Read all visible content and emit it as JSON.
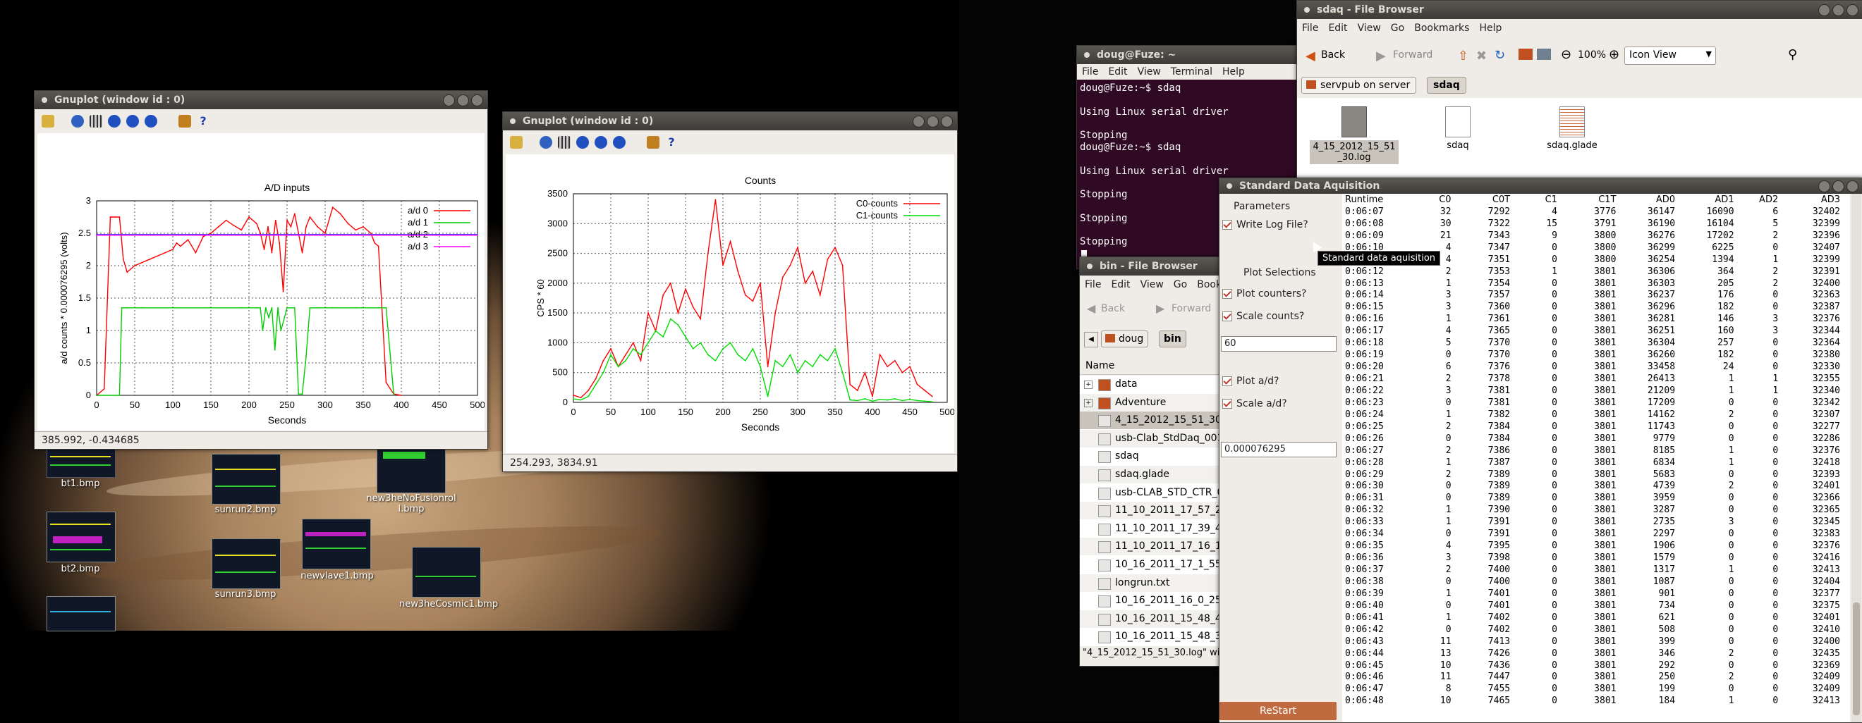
{
  "gnuplot_ad": {
    "title": "Gnuplot (window id : 0)",
    "chart_title": "A/D inputs",
    "status": "385.992, -0.434685",
    "chart_data": {
      "type": "line",
      "title": "A/D inputs",
      "xlabel": "Seconds",
      "ylabel": "a/d counts * 0.000076295 (volts)",
      "xlim": [
        0,
        500
      ],
      "ylim": [
        0,
        3
      ],
      "x_ticks": [
        "0",
        "50",
        "100",
        "150",
        "200",
        "250",
        "300",
        "350",
        "400",
        "450",
        "500"
      ],
      "y_ticks": [
        "0",
        "0.5",
        "1",
        "1.5",
        "2",
        "2.5",
        "3"
      ],
      "grid": true,
      "legend": "top-right",
      "series": [
        {
          "name": "a/d 0",
          "color": "#ff0000",
          "x": [
            0,
            10,
            18,
            20,
            25,
            30,
            35,
            40,
            50,
            70,
            90,
            100,
            105,
            110,
            120,
            130,
            140,
            150,
            160,
            170,
            180,
            190,
            200,
            210,
            215,
            220,
            225,
            230,
            235,
            240,
            245,
            250,
            255,
            260,
            265,
            270,
            275,
            280,
            290,
            300,
            310,
            320,
            330,
            340,
            350,
            360,
            365,
            370,
            380,
            390,
            400
          ],
          "y": [
            0,
            0.1,
            2.75,
            2.75,
            2.75,
            2.75,
            2.1,
            1.9,
            2.0,
            2.1,
            2.2,
            2.25,
            2.35,
            2.3,
            2.4,
            2.2,
            2.45,
            2.5,
            2.6,
            2.7,
            2.62,
            2.55,
            2.75,
            2.65,
            2.5,
            2.25,
            2.6,
            2.2,
            2.7,
            2.35,
            1.6,
            2.7,
            2.6,
            2.8,
            2.5,
            2.2,
            2.6,
            2.75,
            2.6,
            2.5,
            2.9,
            2.8,
            2.65,
            2.55,
            2.6,
            2.5,
            2.35,
            2.3,
            0.2,
            0.02,
            0
          ]
        },
        {
          "name": "a/d 1",
          "color": "#00cc00",
          "x": [
            0,
            30,
            33,
            36,
            40,
            60,
            100,
            150,
            190,
            200,
            210,
            215,
            218,
            222,
            226,
            230,
            234,
            238,
            242,
            250,
            260,
            265,
            270,
            275,
            280,
            290,
            300,
            310,
            340,
            348,
            350,
            370,
            380,
            390
          ],
          "y": [
            0,
            0,
            1.35,
            1.35,
            1.35,
            1.35,
            1.35,
            1.35,
            1.35,
            1.35,
            1.35,
            1.35,
            1.0,
            1.35,
            1.2,
            1.35,
            0.7,
            1.35,
            1.0,
            1.35,
            1.35,
            0.02,
            0.02,
            0.6,
            1.35,
            1.35,
            1.35,
            1.35,
            1.35,
            1.35,
            1.35,
            1.35,
            1.35,
            0.02
          ]
        },
        {
          "name": "a/d 2",
          "color": "#3333ff",
          "x": [
            0,
            500
          ],
          "y": [
            2.48,
            2.48
          ]
        },
        {
          "name": "a/d 3",
          "color": "#ff00ff",
          "x": [
            0,
            500
          ],
          "y": [
            2.47,
            2.47
          ]
        }
      ]
    }
  },
  "gnuplot_counts": {
    "title": "Gnuplot (window id : 0)",
    "chart_title": "Counts",
    "status": "254.293,  3834.91",
    "chart_data": {
      "type": "line",
      "title": "Counts",
      "xlabel": "Seconds",
      "ylabel": "CPS * 60",
      "xlim": [
        0,
        500
      ],
      "ylim": [
        0,
        3500
      ],
      "x_ticks": [
        "0",
        "50",
        "100",
        "150",
        "200",
        "250",
        "300",
        "350",
        "400",
        "450",
        "500"
      ],
      "y_ticks": [
        "0",
        "500",
        "1000",
        "1500",
        "2000",
        "2500",
        "3000",
        "3500"
      ],
      "grid": true,
      "legend": "top-right",
      "series": [
        {
          "name": "C0-counts",
          "color": "#ff0000",
          "x": [
            0,
            10,
            20,
            30,
            40,
            50,
            60,
            70,
            80,
            90,
            100,
            110,
            120,
            130,
            140,
            150,
            160,
            170,
            180,
            190,
            200,
            210,
            220,
            230,
            240,
            250,
            260,
            270,
            280,
            290,
            300,
            310,
            320,
            330,
            340,
            350,
            360,
            370,
            380,
            390,
            400,
            410,
            420,
            430,
            440,
            450,
            460,
            470,
            480
          ],
          "y": [
            120,
            80,
            200,
            400,
            700,
            900,
            600,
            800,
            1000,
            700,
            1500,
            1200,
            1800,
            2000,
            1500,
            1900,
            1600,
            1400,
            2500,
            3400,
            2300,
            2700,
            2200,
            1800,
            1700,
            2000,
            600,
            1500,
            2100,
            2300,
            2600,
            2000,
            2200,
            1800,
            2400,
            2600,
            2300,
            300,
            200,
            500,
            100,
            800,
            600,
            700,
            500,
            600,
            300,
            200,
            100
          ]
        },
        {
          "name": "C1-counts",
          "color": "#00dd00",
          "x": [
            0,
            10,
            20,
            30,
            40,
            50,
            60,
            70,
            80,
            90,
            100,
            110,
            120,
            130,
            140,
            150,
            160,
            170,
            180,
            190,
            200,
            210,
            220,
            230,
            240,
            250,
            260,
            270,
            280,
            290,
            300,
            310,
            320,
            330,
            340,
            350,
            360,
            370,
            380,
            390,
            400,
            410,
            420,
            430,
            440,
            450,
            460,
            470,
            480
          ],
          "y": [
            60,
            40,
            100,
            300,
            500,
            800,
            600,
            700,
            900,
            800,
            1000,
            1200,
            1100,
            1400,
            1300,
            1100,
            900,
            1000,
            800,
            700,
            900,
            1000,
            800,
            700,
            900,
            600,
            100,
            700,
            600,
            800,
            500,
            700,
            600,
            800,
            700,
            900,
            500,
            40,
            30,
            60,
            20,
            50,
            40,
            60,
            30,
            50,
            30,
            20,
            10
          ]
        }
      ]
    }
  },
  "desktop_icons": [
    {
      "label": "bt1.bmp"
    },
    {
      "label": "bt2.bmp"
    },
    {
      "label": "sunrun2.bmp"
    },
    {
      "label": "sunrun3.bmp"
    },
    {
      "label": "newvlave1.bmp"
    },
    {
      "label": "new3heNoFusionroll.bmp"
    },
    {
      "label": "new3heCosmic1.bmp"
    }
  ],
  "terminal": {
    "title": "doug@Fuze: ~",
    "menu": [
      "File",
      "Edit",
      "View",
      "Terminal",
      "Help"
    ],
    "lines": [
      "doug@Fuze:~$ sdaq",
      "",
      "Using Linux serial driver",
      "",
      "Stopping",
      "doug@Fuze:~$ sdaq",
      "",
      "Using Linux serial driver",
      "",
      "Stopping",
      "",
      "Stopping",
      "",
      "Stopping"
    ]
  },
  "file_browser_sdaq": {
    "title": "sdaq - File Browser",
    "menu": [
      "File",
      "Edit",
      "View",
      "Go",
      "Bookmarks",
      "Help"
    ],
    "back": "Back",
    "forward": "Forward",
    "zoom": "100%",
    "view_mode": "Icon View",
    "path_server": "servpub on server",
    "path_current": "sdaq",
    "files": [
      "4_15_2012_15_51_30.log",
      "sdaq",
      "sdaq.glade"
    ]
  },
  "file_browser_bin": {
    "title": "bin - File Browser",
    "menu": [
      "File",
      "Edit",
      "View",
      "Go",
      "Bookmarks"
    ],
    "back": "Back",
    "forward": "Forward",
    "path_home": "doug",
    "path_current": "bin",
    "column": "Name",
    "items": [
      "data",
      "Adventure",
      "4_15_2012_15_51_30.",
      "usb-Clab_StdDaq_001",
      "sdaq",
      "sdaq.glade",
      "usb-CLAB_STD_CTR_0",
      "11_10_2011_17_57_24",
      "11_10_2011_17_39_42",
      "11_10_2011_17_16_10",
      "10_16_2011_17_1_55.",
      "longrun.txt",
      "10_16_2011_16_0_25.",
      "10_16_2011_15_48_41",
      "10_16_2011_15_48_37"
    ],
    "status": "\"4_15_2012_15_51_30.log\" wi"
  },
  "sdaq_window": {
    "title": "Standard Data Aquisition",
    "tooltip": "Standard data aquisition",
    "params_label": "Parameters",
    "write_log": "Write Log File?",
    "plot_selections": "Plot Selections",
    "plot_counters": "Plot counters?",
    "scale_counts": "Scale counts?",
    "scale_counts_value": "60",
    "plot_ad": "Plot a/d?",
    "scale_ad": "Scale a/d?",
    "scale_ad_value": "0.000076295",
    "restart": "ReStart",
    "columns": [
      "Runtime",
      "C0",
      "C0T",
      "C1",
      "C1T",
      "AD0",
      "AD1",
      "AD2",
      "AD3"
    ],
    "rows": [
      [
        "0:06:07",
        "32",
        "7292",
        "4",
        "3776",
        "36147",
        "16090",
        "6",
        "32402"
      ],
      [
        "0:06:08",
        "30",
        "7322",
        "15",
        "3791",
        "36190",
        "16104",
        "5",
        "32399"
      ],
      [
        "0:06:09",
        "21",
        "7343",
        "9",
        "3800",
        "36276",
        "17202",
        "2",
        "32396"
      ],
      [
        "0:06:10",
        "4",
        "7347",
        "0",
        "3800",
        "36299",
        "6225",
        "0",
        "32407"
      ],
      [
        "0:06:11",
        "4",
        "7351",
        "0",
        "3800",
        "36254",
        "1394",
        "1",
        "32399"
      ],
      [
        "0:06:12",
        "2",
        "7353",
        "1",
        "3801",
        "36306",
        "364",
        "2",
        "32391"
      ],
      [
        "0:06:13",
        "1",
        "7354",
        "0",
        "3801",
        "36303",
        "205",
        "2",
        "32400"
      ],
      [
        "0:06:14",
        "3",
        "7357",
        "0",
        "3801",
        "36237",
        "176",
        "0",
        "32363"
      ],
      [
        "0:06:15",
        "3",
        "7360",
        "0",
        "3801",
        "36296",
        "182",
        "0",
        "32387"
      ],
      [
        "0:06:16",
        "1",
        "7361",
        "0",
        "3801",
        "36281",
        "146",
        "3",
        "32376"
      ],
      [
        "0:06:17",
        "4",
        "7365",
        "0",
        "3801",
        "36251",
        "160",
        "3",
        "32344"
      ],
      [
        "0:06:18",
        "5",
        "7370",
        "0",
        "3801",
        "36304",
        "257",
        "0",
        "32364"
      ],
      [
        "0:06:19",
        "0",
        "7370",
        "0",
        "3801",
        "36260",
        "182",
        "0",
        "32380"
      ],
      [
        "0:06:20",
        "6",
        "7376",
        "0",
        "3801",
        "33458",
        "24",
        "0",
        "32330"
      ],
      [
        "0:06:21",
        "2",
        "7378",
        "0",
        "3801",
        "26413",
        "1",
        "1",
        "32355"
      ],
      [
        "0:06:22",
        "3",
        "7381",
        "0",
        "3801",
        "21209",
        "1",
        "1",
        "32340"
      ],
      [
        "0:06:23",
        "0",
        "7381",
        "0",
        "3801",
        "17209",
        "0",
        "0",
        "32342"
      ],
      [
        "0:06:24",
        "1",
        "7382",
        "0",
        "3801",
        "14162",
        "2",
        "0",
        "32307"
      ],
      [
        "0:06:25",
        "2",
        "7384",
        "0",
        "3801",
        "11743",
        "0",
        "0",
        "32277"
      ],
      [
        "0:06:26",
        "0",
        "7384",
        "0",
        "3801",
        "9779",
        "0",
        "0",
        "32286"
      ],
      [
        "0:06:27",
        "2",
        "7386",
        "0",
        "3801",
        "8185",
        "1",
        "0",
        "32376"
      ],
      [
        "0:06:28",
        "1",
        "7387",
        "0",
        "3801",
        "6834",
        "1",
        "0",
        "32418"
      ],
      [
        "0:06:29",
        "2",
        "7389",
        "0",
        "3801",
        "5683",
        "0",
        "0",
        "32393"
      ],
      [
        "0:06:30",
        "0",
        "7389",
        "0",
        "3801",
        "4739",
        "2",
        "0",
        "32401"
      ],
      [
        "0:06:31",
        "0",
        "7389",
        "0",
        "3801",
        "3959",
        "0",
        "0",
        "32366"
      ],
      [
        "0:06:32",
        "1",
        "7390",
        "0",
        "3801",
        "3287",
        "0",
        "0",
        "32365"
      ],
      [
        "0:06:33",
        "1",
        "7391",
        "0",
        "3801",
        "2735",
        "3",
        "0",
        "32345"
      ],
      [
        "0:06:34",
        "0",
        "7391",
        "0",
        "3801",
        "2297",
        "0",
        "0",
        "32383"
      ],
      [
        "0:06:35",
        "4",
        "7395",
        "0",
        "3801",
        "1906",
        "0",
        "0",
        "32376"
      ],
      [
        "0:06:36",
        "3",
        "7398",
        "0",
        "3801",
        "1579",
        "0",
        "0",
        "32416"
      ],
      [
        "0:06:37",
        "2",
        "7400",
        "0",
        "3801",
        "1317",
        "1",
        "0",
        "32413"
      ],
      [
        "0:06:38",
        "0",
        "7400",
        "0",
        "3801",
        "1087",
        "0",
        "0",
        "32404"
      ],
      [
        "0:06:39",
        "1",
        "7401",
        "0",
        "3801",
        "901",
        "0",
        "0",
        "32377"
      ],
      [
        "0:06:40",
        "0",
        "7401",
        "0",
        "3801",
        "734",
        "0",
        "0",
        "32375"
      ],
      [
        "0:06:41",
        "1",
        "7402",
        "0",
        "3801",
        "621",
        "0",
        "0",
        "32401"
      ],
      [
        "0:06:42",
        "0",
        "7402",
        "0",
        "3801",
        "508",
        "0",
        "0",
        "32410"
      ],
      [
        "0:06:43",
        "11",
        "7413",
        "0",
        "3801",
        "399",
        "0",
        "0",
        "32400"
      ],
      [
        "0:06:44",
        "13",
        "7426",
        "0",
        "3801",
        "346",
        "2",
        "0",
        "32435"
      ],
      [
        "0:06:45",
        "10",
        "7436",
        "0",
        "3801",
        "292",
        "0",
        "0",
        "32369"
      ],
      [
        "0:06:46",
        "11",
        "7447",
        "0",
        "3801",
        "250",
        "2",
        "0",
        "32409"
      ],
      [
        "0:06:47",
        "8",
        "7455",
        "0",
        "3801",
        "199",
        "0",
        "0",
        "32409"
      ],
      [
        "0:06:48",
        "10",
        "7465",
        "0",
        "3801",
        "184",
        "1",
        "0",
        "32413"
      ]
    ]
  }
}
